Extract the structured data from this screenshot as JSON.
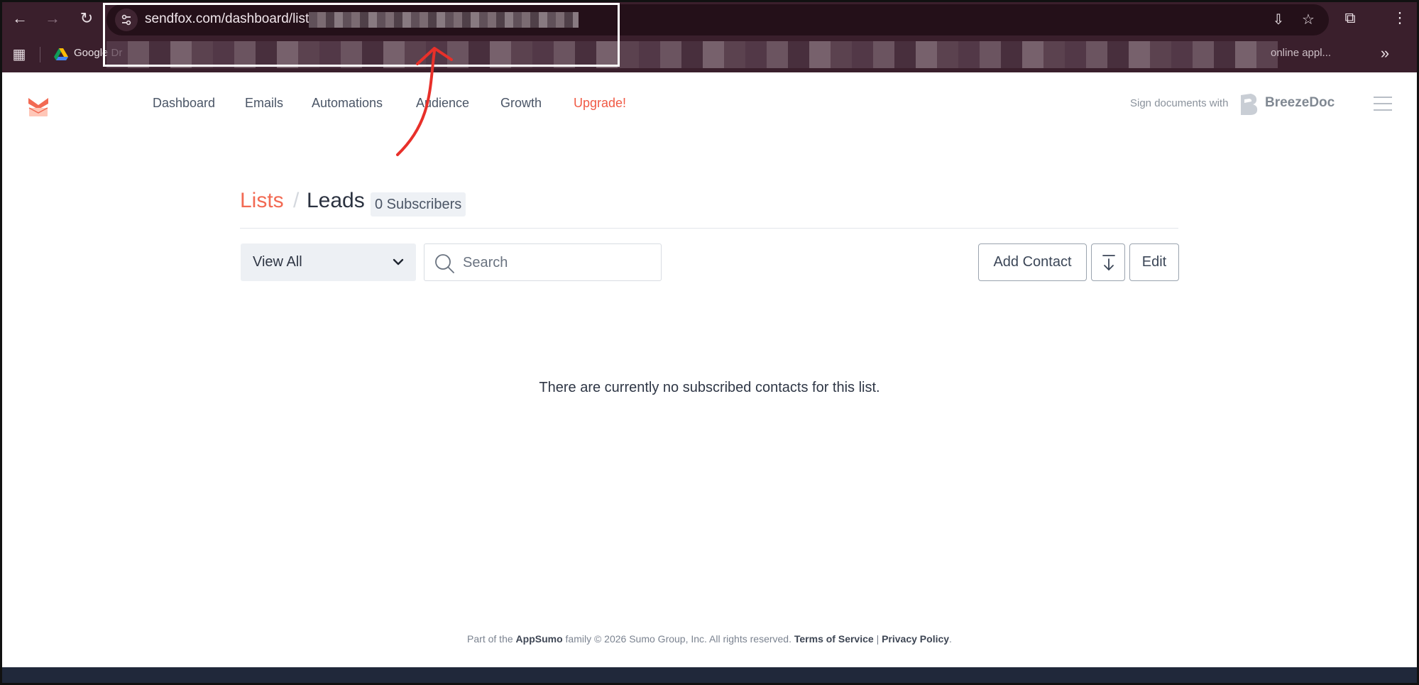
{
  "browser": {
    "url": "sendfox.com/dashboard/list",
    "bookmarks": {
      "first_label": "Google Dr",
      "right_label": "online appl..."
    },
    "colors": {
      "chrome": "#3a1f2c",
      "omnibox": "#241019"
    }
  },
  "app": {
    "nav": {
      "dashboard": "Dashboard",
      "emails": "Emails",
      "automations": "Automations",
      "audience": "Audience",
      "growth": "Growth",
      "upgrade": "Upgrade!"
    },
    "promo": {
      "text": "Sign documents with",
      "brand": "BreezeDoc"
    },
    "colors": {
      "accent": "#f05a45",
      "text": "#2b3240"
    }
  },
  "page": {
    "breadcrumb": {
      "lists": "Lists",
      "separator": "/",
      "current": "Leads"
    },
    "subscriber_badge": "0 Subscribers",
    "filter": {
      "selected": "View All"
    },
    "search": {
      "placeholder": "Search",
      "value": ""
    },
    "buttons": {
      "add_contact": "Add Contact",
      "edit": "Edit"
    },
    "empty_message": "There are currently no subscribed contacts for this list."
  },
  "footer": {
    "prefix": "Part of the",
    "brand": "AppSumo",
    "middle": "family © 2026 Sumo Group, Inc. All rights reserved.",
    "terms": "Terms of Service",
    "separator": "|",
    "privacy": "Privacy Policy",
    "end": "."
  }
}
